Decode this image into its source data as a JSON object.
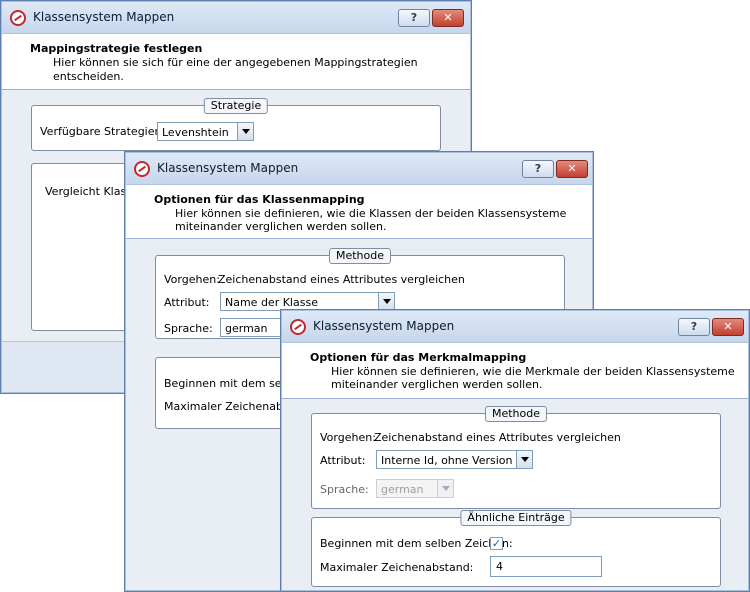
{
  "window1": {
    "title": "Klassensystem Mappen",
    "help_label": "?",
    "close_label": "✕",
    "header_title": "Mappingstrategie festlegen",
    "header_subtitle": "Hier können sie sich für eine der angegebenen Mappingstrategien entscheiden.",
    "group_strategy": "Strategie",
    "strategies_label": "Verfügbare Strategien:",
    "strategy_value": "Levenshtein",
    "partial_text": "Vergleicht Klasse"
  },
  "window2": {
    "title": "Klassensystem Mappen",
    "help_label": "?",
    "close_label": "✕",
    "header_title": "Optionen für das Klassenmapping",
    "header_line1": "Hier können sie definieren, wie die Klassen der beiden Klassensysteme",
    "header_line2": "miteinander verglichen werden sollen.",
    "group_method": "Methode",
    "procedure_label": "Vorgehen:",
    "procedure_value": "Zeichenabstand eines Attributes vergleichen",
    "attribute_label": "Attribut:",
    "attribute_value": "Name der Klasse",
    "language_label": "Sprache:",
    "language_value": "german",
    "begin_label": "Beginnen mit dem selben",
    "maxdist_label": "Maximaler Zeichenabstand"
  },
  "window3": {
    "title": "Klassensystem Mappen",
    "help_label": "?",
    "close_label": "✕",
    "header_title": "Optionen für das Merkmalmapping",
    "header_line1": "Hier können sie definieren, wie die Merkmale der beiden Klassensysteme",
    "header_line2": "miteinander verglichen werden sollen.",
    "group_method": "Methode",
    "procedure_label": "Vorgehen:",
    "procedure_value": "Zeichenabstand eines Attributes vergleichen",
    "attribute_label": "Attribut:",
    "attribute_value": "Interne Id, ohne Version",
    "language_label": "Sprache:",
    "language_value": "german",
    "group_similar": "Ähnliche Einträge",
    "begin_label": "Beginnen mit dem selben Zeichen:",
    "begin_checked_mark": "✓",
    "maxdist_label": "Maximaler Zeichenabstand:",
    "maxdist_value": "4"
  }
}
